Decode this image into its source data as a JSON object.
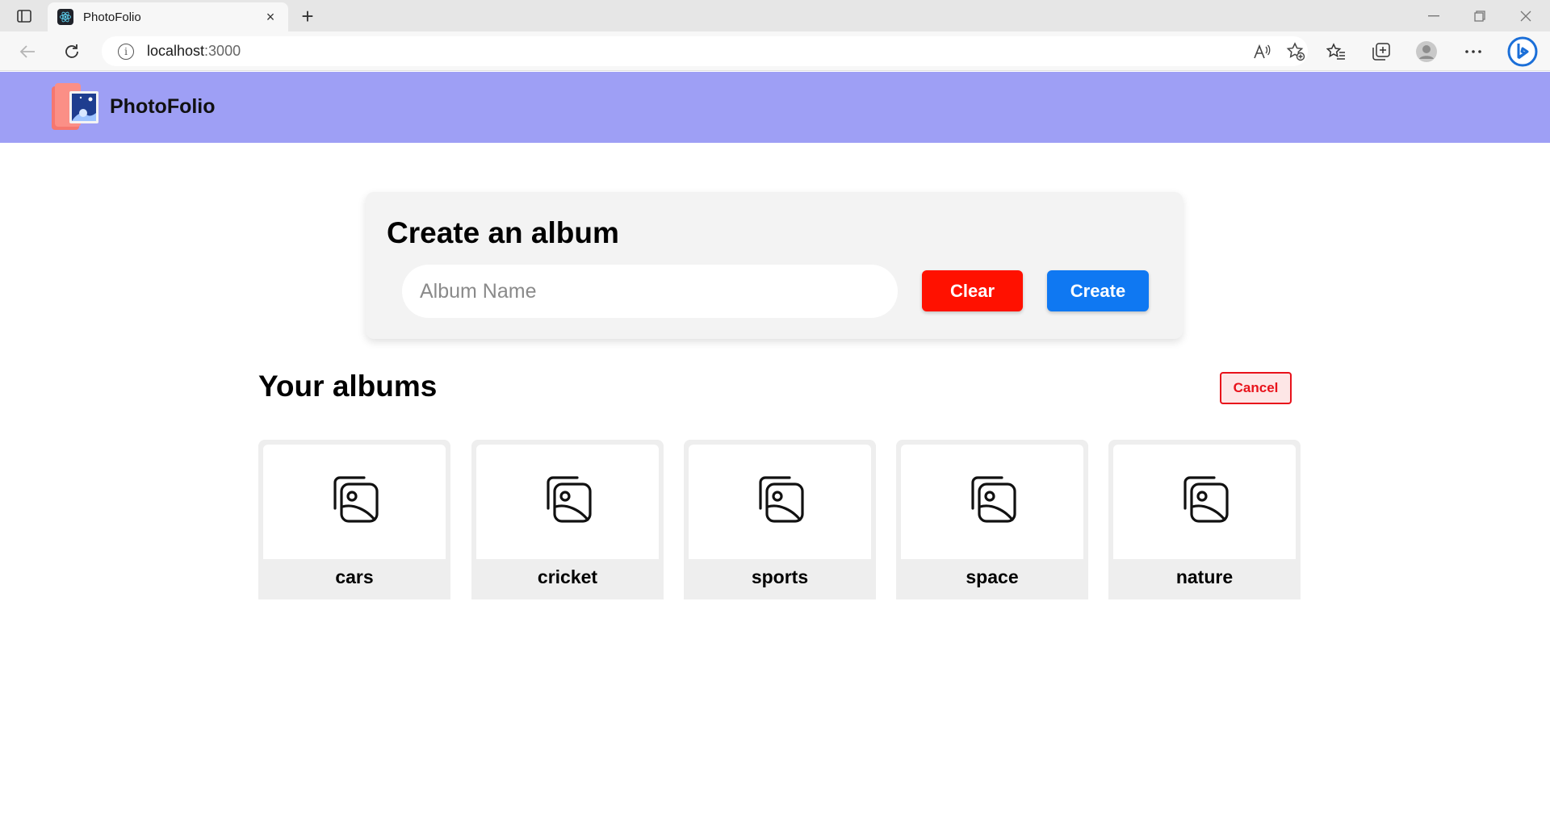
{
  "browser": {
    "tab_title": "PhotoFolio",
    "tab_close": "×",
    "new_tab": "+",
    "url_host": "localhost",
    "url_port": ":3000",
    "window_controls": [
      "minimize",
      "restore",
      "close"
    ]
  },
  "header": {
    "brand": "PhotoFolio"
  },
  "create_form": {
    "title": "Create an album",
    "input_placeholder": "Album Name",
    "input_value": "",
    "clear_label": "Clear",
    "create_label": "Create"
  },
  "albums_section": {
    "title": "Your albums",
    "cancel_label": "Cancel",
    "albums": [
      {
        "name": "cars"
      },
      {
        "name": "cricket"
      },
      {
        "name": "sports"
      },
      {
        "name": "space"
      },
      {
        "name": "nature"
      }
    ]
  },
  "colors": {
    "header_bg": "#9e9ff5",
    "clear_button": "#ff1100",
    "create_button": "#0f78f2",
    "cancel_border": "#e8121b"
  }
}
